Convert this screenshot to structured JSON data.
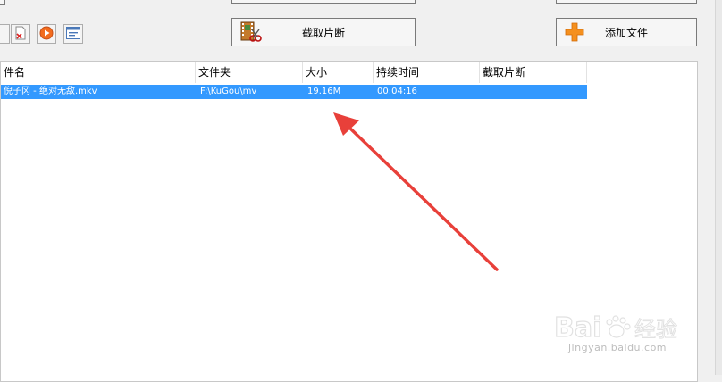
{
  "toolbar": {
    "clip_button_label": "截取片断",
    "add_file_button_label": "添加文件"
  },
  "file_list": {
    "columns": [
      "件名",
      "文件夹",
      "大小",
      "持续时间",
      "截取片断"
    ],
    "rows": [
      {
        "name": "倪子冈 - 绝对无敌.mkv",
        "folder": "F:\\KuGou\\mv",
        "size": "19.16M",
        "duration": "00:04:16",
        "clip": ""
      }
    ]
  },
  "watermark": {
    "logo_text": "Baidu经验",
    "url_text": "jingyan.baidu.com"
  },
  "colors": {
    "selection": "#3399ff",
    "arrow": "#e8403a",
    "add_icon": "#f5901e",
    "play_icon": "#f26b1d"
  }
}
